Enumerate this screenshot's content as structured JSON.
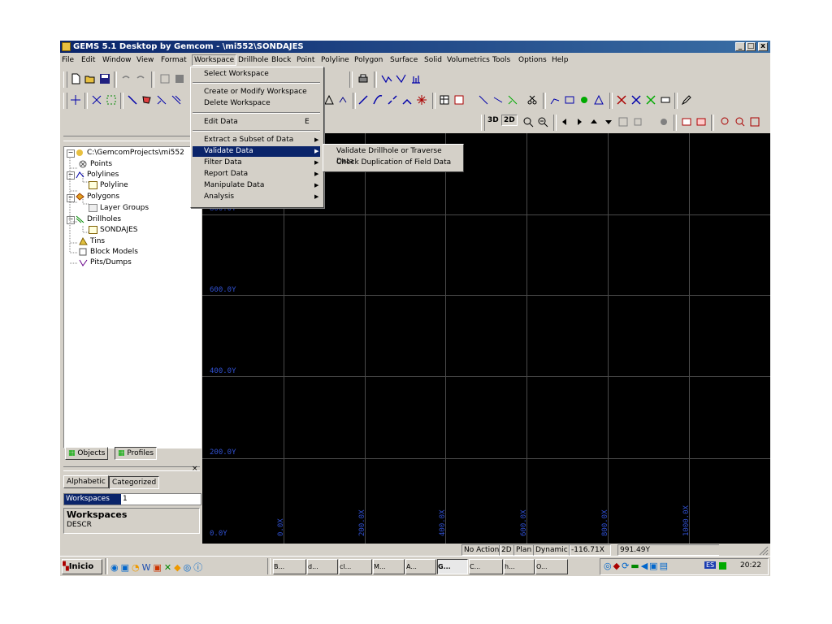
{
  "window": {
    "title": "GEMS 5.1 Desktop by Gemcom - \\mi552\\SONDAJES",
    "min": "_",
    "max": "□",
    "close": "x"
  },
  "menubar": [
    "File",
    "Edit",
    "Window",
    "View",
    "Format",
    "Workspace",
    "Drillhole",
    "Block",
    "Point",
    "Polyline",
    "Polygon",
    "Surface",
    "Solid",
    "Volumetrics",
    "Tools",
    "Options",
    "Help"
  ],
  "workspace_menu": {
    "items": [
      {
        "label": "Select Workspace"
      },
      {
        "label": "Create or Modify Workspace"
      },
      {
        "label": "Delete Workspace"
      },
      {
        "label": "Edit Data",
        "shortcut": "E"
      },
      {
        "label": "Extract a Subset of Data",
        "submenu": true
      },
      {
        "label": "Validate Data",
        "submenu": true,
        "highlighted": true
      },
      {
        "label": "Filter Data",
        "submenu": true
      },
      {
        "label": "Report Data",
        "submenu": true
      },
      {
        "label": "Manipulate Data",
        "submenu": true
      },
      {
        "label": "Analysis",
        "submenu": true
      }
    ]
  },
  "validate_submenu": [
    "Validate Drillhole or Traverse Data",
    "Check Duplication of Field Data"
  ],
  "toolbar": {
    "btn_3d": "3D",
    "btn_2d": "2D"
  },
  "tree": {
    "root": "C:\\GemcomProjects\\mi552",
    "points": "Points",
    "polylines": "Polylines",
    "polyline": "Polyline",
    "polygons": "Polygons",
    "layer_groups": "Layer Groups",
    "drillholes": "Drillholes",
    "sondajes": "SONDAJES",
    "tins": "Tins",
    "block_models": "Block Models",
    "pits_dumps": "Pits/Dumps"
  },
  "tabs": {
    "objects": "Objects",
    "profiles": "Profiles"
  },
  "properties": {
    "tab_alphabetic": "Alphabetic",
    "tab_categorized": "Categorized",
    "row_label": "Workspaces",
    "row_value": "1",
    "desc_title": "Workspaces",
    "desc_text": "DESCR",
    "close": "×"
  },
  "canvas": {
    "y_labels": [
      "800.0Y",
      "600.0Y",
      "400.0Y",
      "200.0Y",
      "0.0Y"
    ],
    "x_labels": [
      "0.0X",
      "200.0X",
      "400.0X",
      "600.0X",
      "800.0X",
      "1000.0X"
    ]
  },
  "status": {
    "action": "No Action",
    "mode": "2D",
    "view": "Plan",
    "dynamic": "Dynamic",
    "x": "-116.71X",
    "y": "991.49Y"
  },
  "taskbar": {
    "start": "Inicio",
    "buttons": [
      "B...",
      "d...",
      "cl...",
      "M...",
      "A...",
      "G...",
      "C...",
      "h...",
      "O..."
    ],
    "lang": "ES",
    "time": "20:22"
  },
  "colors": {
    "titlebar": "#0a246a",
    "highlight": "#0a246a",
    "canvas": "#000000",
    "axis_labels": "#3050d0"
  }
}
